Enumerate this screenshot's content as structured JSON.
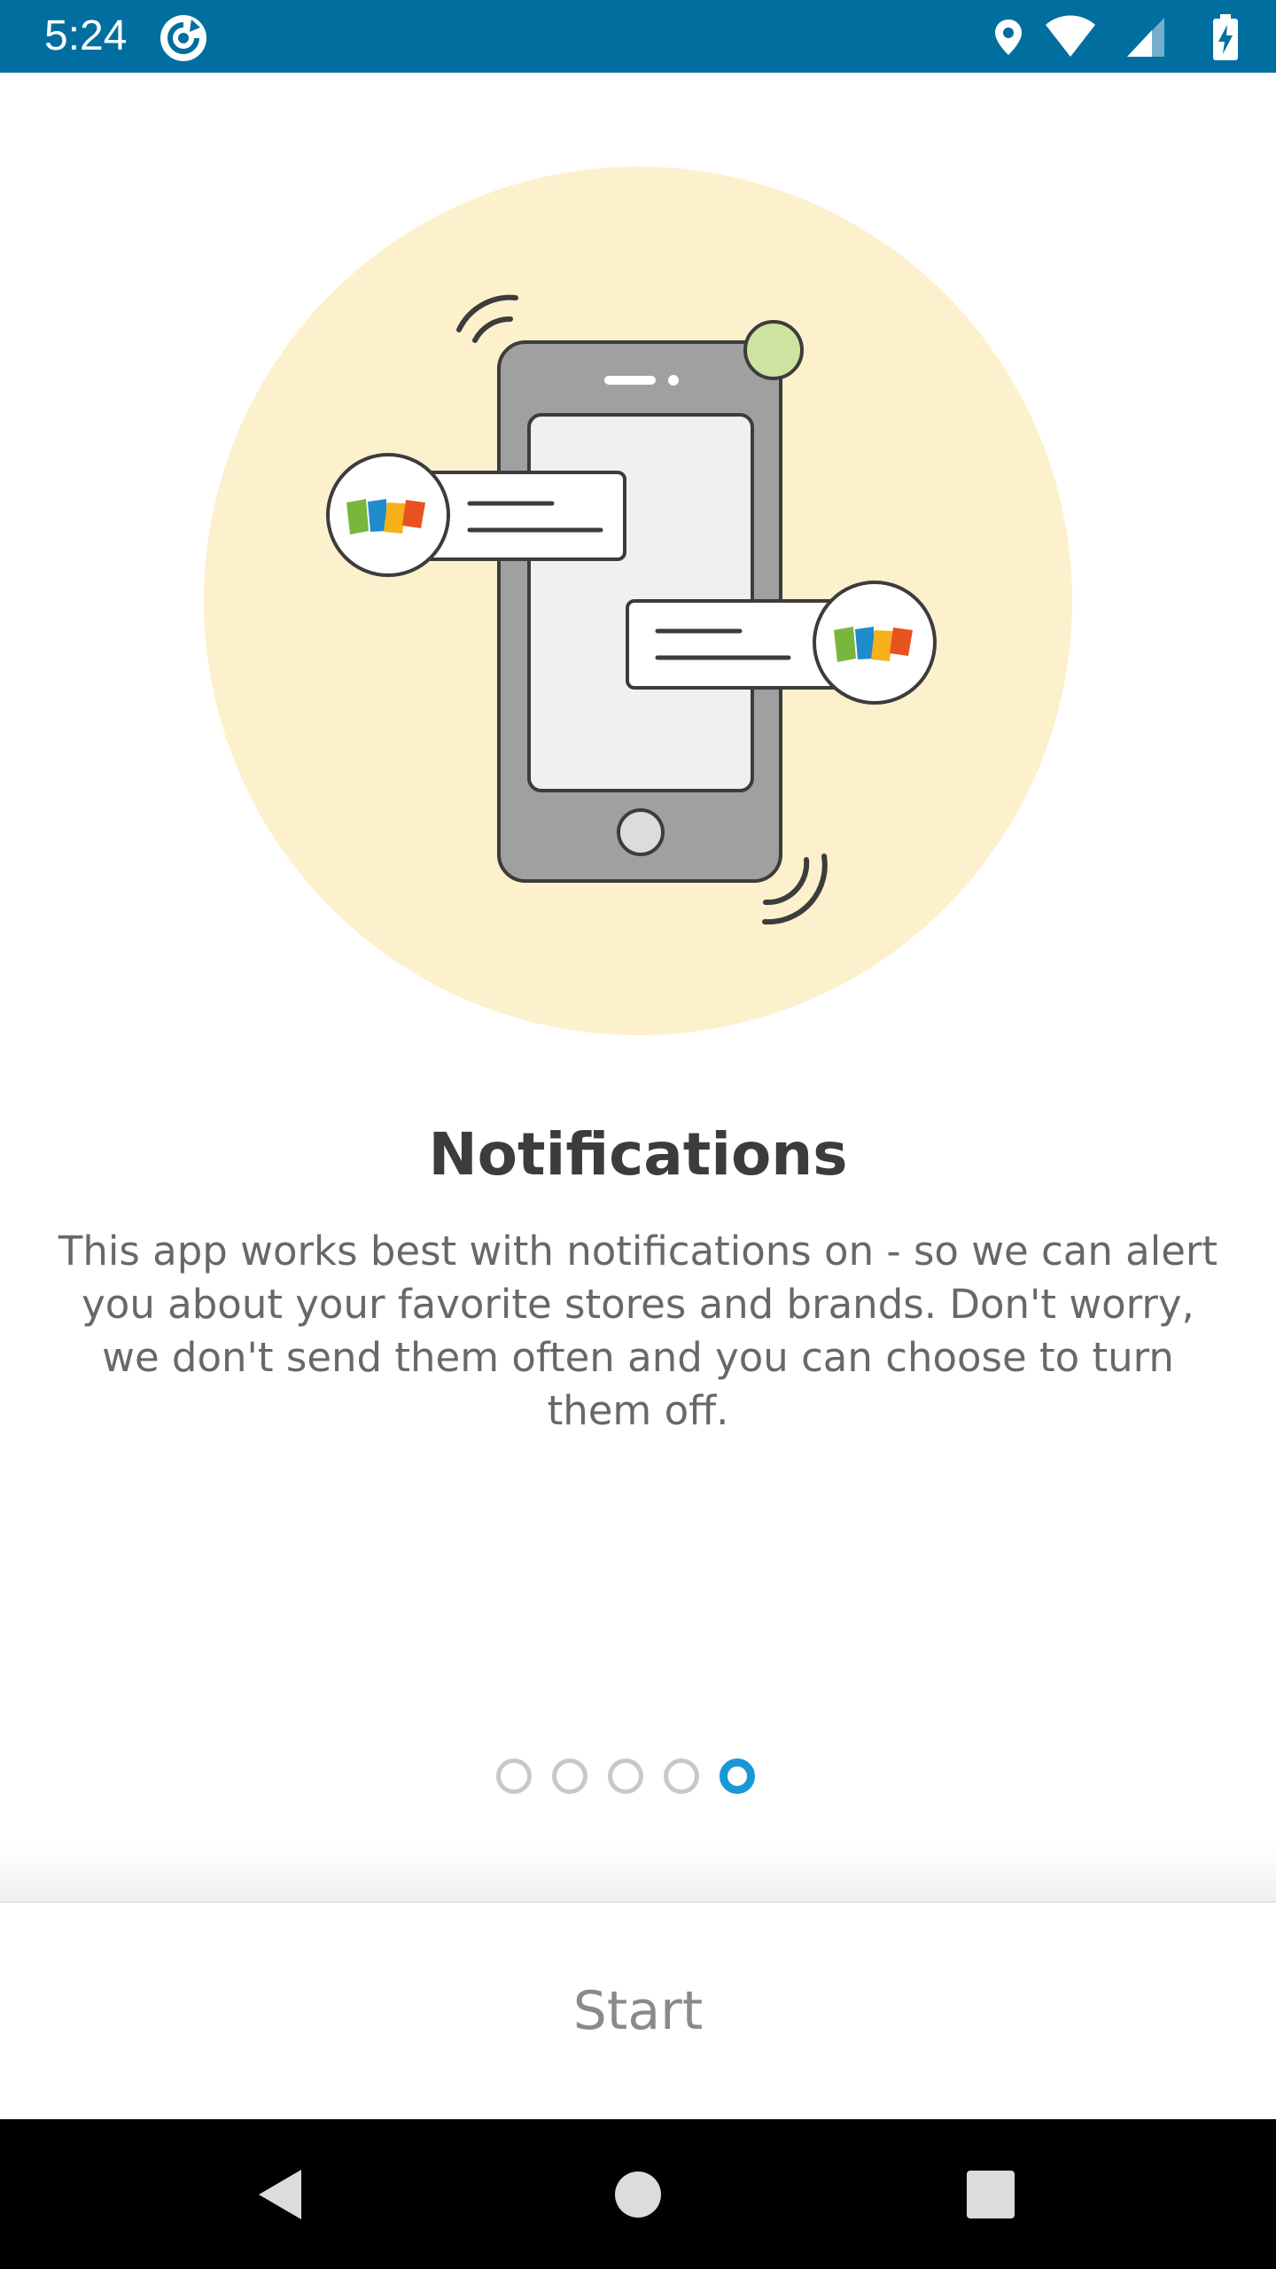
{
  "status_bar": {
    "time": "5:24",
    "background_color": "#006e9e",
    "icons": [
      "app-sync-icon",
      "location-icon",
      "wifi-icon",
      "cell-signal-icon",
      "battery-charging-icon"
    ]
  },
  "onboarding": {
    "title": "Notifications",
    "description": "This app works best with notifications on - so we can alert you about your favorite stores and brands. Don't worry, we don't send them often and you can choose to turn them off.",
    "illustration_icon": "phone-notifications-illustration",
    "page_indicator": {
      "total": 5,
      "current": 5,
      "active_color": "#1a97d5",
      "inactive_color": "#c8c8c8"
    },
    "start_button_label": "Start"
  },
  "nav_bar": {
    "buttons": [
      "back-icon",
      "home-icon",
      "recents-icon"
    ]
  }
}
